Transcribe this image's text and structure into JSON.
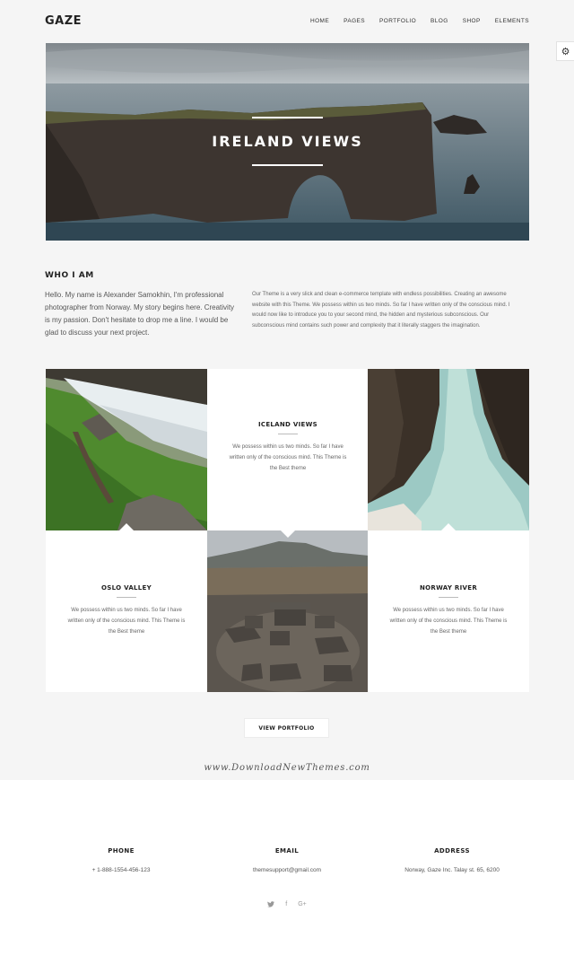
{
  "header": {
    "logo": "GAZE",
    "nav": [
      "HOME",
      "PAGES",
      "PORTFOLIO",
      "BLOG",
      "SHOP",
      "ELEMENTS"
    ]
  },
  "settings": {
    "icon": "gear-icon",
    "glyph": "⚙"
  },
  "hero": {
    "title": "IRELAND VIEWS"
  },
  "about": {
    "title": "WHO I AM",
    "left": "Hello. My name is Alexander Samokhin, I'm professional photographer from Norway. My story begins here. Creativity is my passion. Don't hesitate to drop me a line. I would be glad to discuss your next project.",
    "right": "Our Theme is a very slick and clean e-commerce template with endless possibilities. Creating an awesome website with this Theme. We possess within us two minds. So far I have written only of the conscious mind. I would now like to introduce you to your second mind, the hidden and mysterious subconscious. Our subconscious mind contains such power and complexity that it literally staggers the imagination."
  },
  "portfolio": {
    "cards": [
      {
        "title": "ICELAND VIEWS",
        "text": "We possess within us two minds. So far I have written only of the conscious mind. This Theme is the Best theme"
      },
      {
        "title": "OSLO VALLEY",
        "text": "We possess within us two minds. So far I have written only of the conscious mind. This Theme is the Best theme"
      },
      {
        "title": "NORWAY RIVER",
        "text": "We possess within us two minds. So far I have written only of the conscious mind. This Theme is the Best theme"
      }
    ],
    "button": "VIEW PORTFOLIO"
  },
  "watermark": "www.DownloadNewThemes.com",
  "footer": {
    "phone": {
      "title": "PHONE",
      "value": "+ 1-888-1554-456-123"
    },
    "email": {
      "title": "EMAIL",
      "value": "themesupport@gmail.com"
    },
    "address": {
      "title": "ADDRESS",
      "value": "Norway, Gaze Inc. Talay st. 65, 6200"
    },
    "social": [
      {
        "icon": "twitter-icon",
        "glyph": "🐦"
      },
      {
        "icon": "facebook-icon",
        "glyph": "f"
      },
      {
        "icon": "google-plus-icon",
        "glyph": "G+"
      }
    ]
  }
}
